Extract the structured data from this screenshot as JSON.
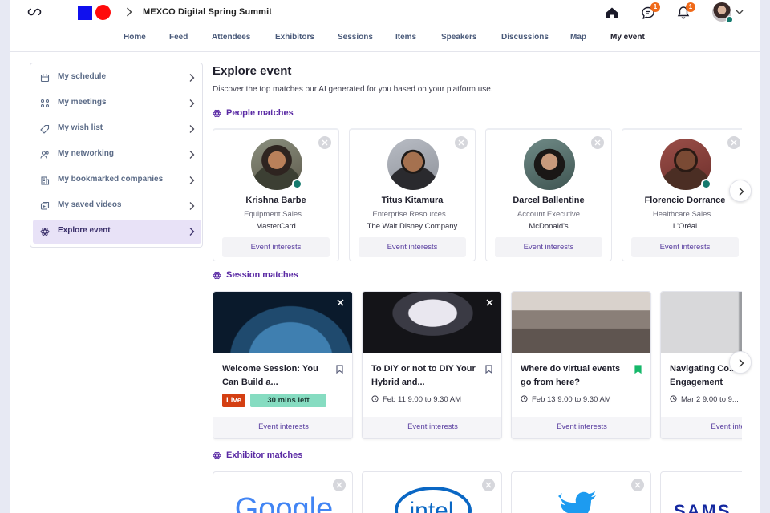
{
  "header": {
    "event_title": "MEXCO Digital Spring Summit",
    "chat_badge": "1",
    "notif_badge": "1",
    "colors": {
      "brand_square": "#1010ee",
      "brand_circle": "#ff0a0a",
      "badge": "#f06a1a",
      "online": "#157a6e"
    }
  },
  "nav": {
    "tabs": [
      "Home",
      "Feed",
      "Attendees",
      "Exhibitors",
      "Sessions",
      "Items",
      "Speakers",
      "Discussions",
      "Map",
      "My event"
    ],
    "active": "My event"
  },
  "sidebar": {
    "items": [
      {
        "label": "My schedule",
        "icon": "calendar-icon"
      },
      {
        "label": "My meetings",
        "icon": "meetings-icon"
      },
      {
        "label": "My wish list",
        "icon": "tag-icon"
      },
      {
        "label": "My networking",
        "icon": "people-icon"
      },
      {
        "label": "My bookmarked companies",
        "icon": "building-icon"
      },
      {
        "label": "My saved videos",
        "icon": "video-icon"
      },
      {
        "label": "Explore event",
        "icon": "atom-icon"
      }
    ],
    "active": "Explore event"
  },
  "main": {
    "title": "Explore event",
    "subtitle": "Discover the top matches our AI generated for you based on your platform use.",
    "people_heading": "People matches",
    "sessions_heading": "Session matches",
    "exhibitors_heading": "Exhibitor matches"
  },
  "people": [
    {
      "name": "Krishna Barbe",
      "role": "Equipment Sales...",
      "company": "MasterCard",
      "button": "Event interests"
    },
    {
      "name": "Titus Kitamura",
      "role": "Enterprise Resources...",
      "company": "The Walt Disney Company",
      "button": "Event interests"
    },
    {
      "name": "Darcel Ballentine",
      "role": "Account Executive",
      "company": "McDonald's",
      "button": "Event interests"
    },
    {
      "name": "Florencio Dorrance",
      "role": "Healthcare Sales...",
      "company": "L'Oréal",
      "button": "Event interests"
    }
  ],
  "sessions": [
    {
      "title": "Welcome Session: You Can Build a...",
      "live_label": "Live",
      "left_label": "30 mins left",
      "button": "Event interests",
      "bookmarked": false
    },
    {
      "title": "To DIY or not to DIY Your Hybrid and...",
      "time": "Feb 11 9:00 to 9:30 AM",
      "button": "Event interests",
      "bookmarked": false
    },
    {
      "title": "Where do virtual events go from here?",
      "time": "Feb 13 9:00 to 9:30 AM",
      "button": "Event interests",
      "bookmarked": true
    },
    {
      "title": "Navigating Co... Engagement",
      "time": "Mar 2 9:00 to 9...",
      "button": "Event inte...",
      "bookmarked": false
    }
  ],
  "exhibitors": [
    {
      "name": "Google",
      "logo_text": "Google"
    },
    {
      "name": "Intel",
      "logo_text": "intel"
    },
    {
      "name": "Twitter",
      "logo_text": ""
    },
    {
      "name": "Samsung",
      "logo_text": "SAMS"
    }
  ]
}
